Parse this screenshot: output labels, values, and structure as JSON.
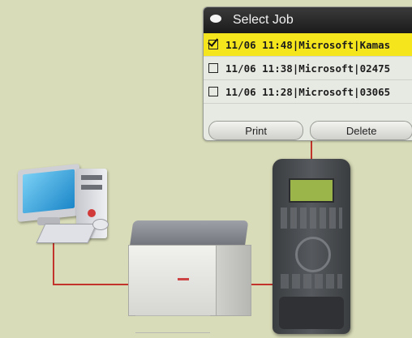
{
  "lcd": {
    "title": "Select Job",
    "jobs": [
      {
        "text": "11/06 11:48|Microsoft|Kamas",
        "checked": true,
        "selected": true
      },
      {
        "text": "11/06 11:38|Microsoft|02475",
        "checked": false,
        "selected": false
      },
      {
        "text": "11/06 11:28|Microsoft|03065",
        "checked": false,
        "selected": false
      }
    ],
    "print_label": "Print",
    "delete_label": "Delete"
  },
  "colors": {
    "background": "#d9dcb8",
    "selected_row": "#f5e51c",
    "connector": "#c2342b"
  },
  "icons": [
    "menu-icon",
    "checkbox-icon",
    "computer-icon",
    "printer-icon",
    "control-panel-icon"
  ]
}
